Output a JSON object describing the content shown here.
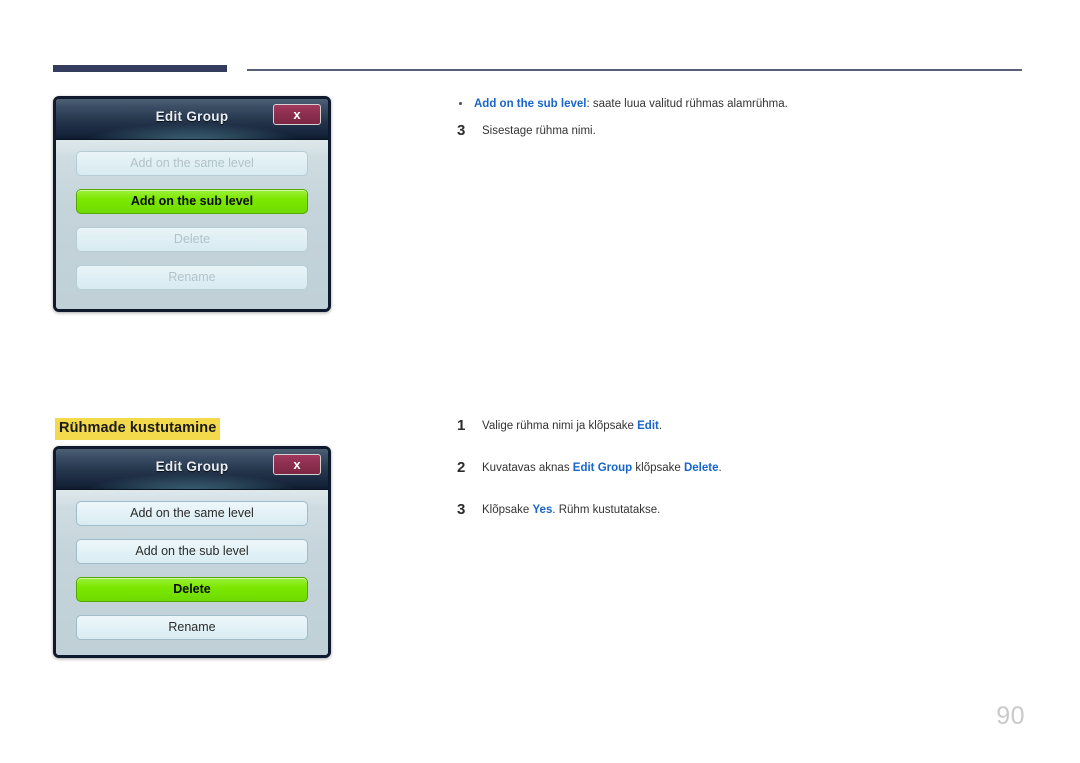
{
  "page": {
    "number": "90"
  },
  "header": {
    "rule_thick_color": "#343c5e",
    "rule_thin_color": "#5a5f7a"
  },
  "section": {
    "heading": "Rühmade kustutamine",
    "highlight_color": "#f2da4c"
  },
  "dialog_one": {
    "title": "Edit Group",
    "close_label": "x",
    "buttons": [
      {
        "label": "Add on the same level",
        "state": "disabled"
      },
      {
        "label": "Add on the sub level",
        "state": "selected"
      },
      {
        "label": "Delete",
        "state": "disabled"
      },
      {
        "label": "Rename",
        "state": "disabled"
      }
    ]
  },
  "dialog_two": {
    "title": "Edit Group",
    "close_label": "x",
    "buttons": [
      {
        "label": "Add on the same level",
        "state": "enabled"
      },
      {
        "label": "Add on the sub level",
        "state": "enabled"
      },
      {
        "label": "Delete",
        "state": "selected"
      },
      {
        "label": "Rename",
        "state": "enabled"
      }
    ]
  },
  "upper_steps": {
    "bullet": {
      "term": "Add on the sub level",
      "rest": ": saate luua valitud rühmas alamrühma."
    },
    "step3": {
      "num": "3",
      "text": "Sisestage rühma nimi."
    }
  },
  "lower_steps": [
    {
      "num": "1",
      "pre": "Valige rühma nimi ja klõpsake ",
      "em1": "Edit",
      "mid": "",
      "em2": "",
      "post": "."
    },
    {
      "num": "2",
      "pre": "Kuvatavas aknas ",
      "em1": "Edit Group",
      "mid": " klõpsake ",
      "em2": "Delete",
      "post": "."
    },
    {
      "num": "3",
      "pre": "Klõpsake ",
      "em1": "Yes",
      "mid": "",
      "em2": "",
      "post": ". Rühm kustutatakse."
    }
  ],
  "colors": {
    "accent_blue": "#1866c9",
    "highlight_green": "#7ce800",
    "close_maroon": "#8e2f50",
    "dialog_navy": "#0f1a2e"
  }
}
